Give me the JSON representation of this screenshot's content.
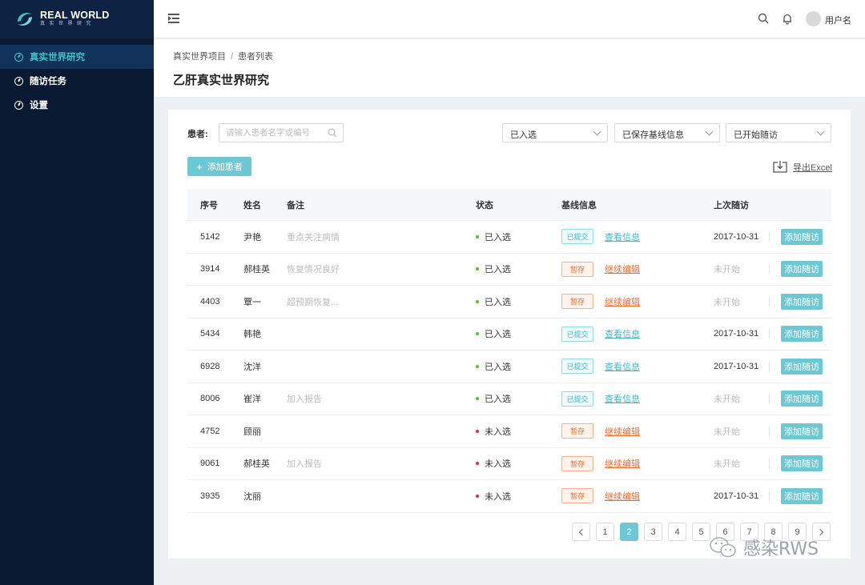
{
  "brand": {
    "title": "REAL WORLD",
    "subtitle": "真实世界研究"
  },
  "sidebar": {
    "items": [
      {
        "label": "真实世界研究",
        "active": true
      },
      {
        "label": "随访任务",
        "active": false
      },
      {
        "label": "设置",
        "active": false
      }
    ]
  },
  "header": {
    "username": "用户名"
  },
  "breadcrumb": {
    "parent": "真实世界项目",
    "separator": "/",
    "current": "患者列表"
  },
  "page_title": "乙肝真实世界研究",
  "filters": {
    "patient_label": "患者:",
    "search_placeholder": "请输入患者名字或编号",
    "select_enroll": "已入选",
    "select_baseline": "已保存基线信息",
    "select_followup": "已开始随访"
  },
  "toolbar": {
    "add_plus": "+",
    "add_label": "添加患者",
    "export_label": "导出Excel"
  },
  "table": {
    "headers": {
      "id": "序号",
      "name": "姓名",
      "note": "备注",
      "status": "状态",
      "baseline": "基线信息",
      "last_visit": "上次随访"
    },
    "rows": [
      {
        "id": "5142",
        "name": "尹艳",
        "note": "重点关注病情",
        "status": "已入选",
        "status_type": "in",
        "tag": "已提交",
        "tag_type": "sub",
        "link": "查看信息",
        "last": "2017-10-31",
        "action": "添加随访"
      },
      {
        "id": "3914",
        "name": "郝桂英",
        "note": "恢复情况良好",
        "status": "已入选",
        "status_type": "in",
        "tag": "暂存",
        "tag_type": "draft",
        "link": "继续编辑",
        "last": "未开始",
        "action": "添加随访"
      },
      {
        "id": "4403",
        "name": "覃一",
        "note": "超预期恢复...",
        "status": "已入选",
        "status_type": "in",
        "tag": "暂存",
        "tag_type": "draft",
        "link": "继续编辑",
        "last": "未开始",
        "action": "添加随访"
      },
      {
        "id": "5434",
        "name": "韩艳",
        "note": "",
        "status": "已入选",
        "status_type": "in",
        "tag": "已提交",
        "tag_type": "sub",
        "link": "查看信息",
        "last": "2017-10-31",
        "action": "添加随访"
      },
      {
        "id": "6928",
        "name": "沈洋",
        "note": "",
        "status": "已入选",
        "status_type": "in",
        "tag": "已提交",
        "tag_type": "sub",
        "link": "查看信息",
        "last": "2017-10-31",
        "action": "添加随访"
      },
      {
        "id": "8006",
        "name": "崔洋",
        "note": "加入报告",
        "status": "已入选",
        "status_type": "in",
        "tag": "已提交",
        "tag_type": "sub",
        "link": "查看信息",
        "last": "未开始",
        "action": "添加随访"
      },
      {
        "id": "4752",
        "name": "顾丽",
        "note": "",
        "status": "未入选",
        "status_type": "out",
        "tag": "暂存",
        "tag_type": "draft",
        "link": "继续编辑",
        "last": "未开始",
        "action": "添加随访"
      },
      {
        "id": "9061",
        "name": "郝桂英",
        "note": "加入报告",
        "status": "未入选",
        "status_type": "out",
        "tag": "暂存",
        "tag_type": "draft",
        "link": "继续编辑",
        "last": "未开始",
        "action": "添加随访"
      },
      {
        "id": "3935",
        "name": "沈丽",
        "note": "",
        "status": "未入选",
        "status_type": "out",
        "tag": "暂存",
        "tag_type": "draft",
        "link": "继续编辑",
        "last": "2017-10-31",
        "action": "添加随访"
      }
    ]
  },
  "pagination": {
    "pages": [
      "1",
      "2",
      "3",
      "4",
      "5",
      "6",
      "7",
      "8",
      "9"
    ],
    "current": "2"
  },
  "watermark": {
    "text": "感染RWS"
  },
  "colors": {
    "accent": "#6cc8d3",
    "sidebar_bg": "#0b1a33",
    "active_text": "#3fc2c4",
    "draft": "#f06a2c",
    "enrolled": "#52c41a",
    "not_enrolled": "#f5222d"
  }
}
